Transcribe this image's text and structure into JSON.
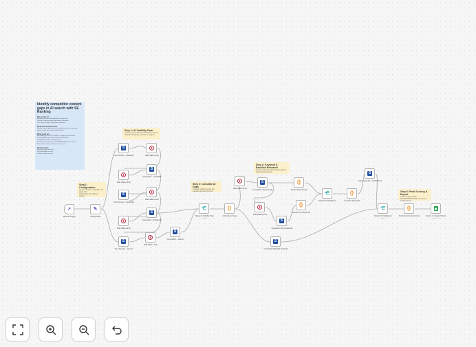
{
  "sticky_notes": {
    "main": {
      "title": "Identify competitor content gaps in AI search with SE Ranking",
      "who_heading": "Who is this for",
      "who_items": [
        "Marketing teams tracking AI SEO performance",
        "Content strategists planning editorial calendars",
        "SEO teams running competitor intelligence"
      ],
      "what_heading": "What this workflow does",
      "what_text": "Identify content opportunities by analyzing where competitors appear in AI search and traditional SEO.",
      "get_heading": "What you'll get",
      "get_items": [
        "AI visibility gaps across ChatGPT, Perplexity, and Gemini",
        "Keyword gaps with search volume and difficulty",
        "Competitor backlink authority metrics",
        "Prioritized opportunities with HIGH/MEDIUM/LOW ranking",
        "Actionable recommendations for each gap"
      ],
      "req_heading": "Requirements",
      "req_items": [
        "Self-hosted n8n instance",
        "SE Ranking API access",
        "Google Sheets account"
      ]
    },
    "step1": {
      "title": "Step 1: Configuration",
      "desc": "Set your domain, competitor, and target data",
      "desc2": "Change brand for different regions"
    },
    "step2": {
      "title": "Step 2: AI Visibility Data",
      "desc": "Fetch AI search data for both domains across ChatGPT, Perplexity, and Gemini engines"
    },
    "step3": {
      "title": "Step 3: Calculate AI Gaps",
      "desc": "Compare visibility metrics and calculate opportunity scores"
    },
    "step4": {
      "title": "Step 4: Keyword & Backlink Research",
      "desc": "Extract competitor top prompts, keywords, and backlink authority"
    },
    "step5": {
      "title": "Step 5: Final Scoring & Export",
      "desc": "Prioritize opportunities (HIGH/MEDIUM/LOW) and export to Google Sheets"
    }
  },
  "nodes": {
    "manual_trigger": {
      "label": "Manual Trigger",
      "icon": "cursor-icon"
    },
    "configuration": {
      "label": "Configuration",
      "icon": "pencil-icon"
    },
    "your_domain_chatgpt": {
      "label": "Your Domain – ChatGPT",
      "icon": "se-ranking-icon"
    },
    "wait_1": {
      "label": "Wait (Rate Limit)",
      "icon": "pause-icon"
    },
    "your_domain_perplexity": {
      "label": "Your Domain – Perplexity",
      "icon": "se-ranking-icon"
    },
    "wait_2": {
      "label": "Wait (Rate Limit)",
      "icon": "pause-icon"
    },
    "your_domain_gemini": {
      "label": "Your Domain – Gemini",
      "icon": "se-ranking-icon"
    },
    "wait_3": {
      "label": "Wait (Rate Limit)",
      "icon": "pause-icon"
    },
    "competitor_chatgpt": {
      "label": "Competitor – ChatGPT",
      "icon": "se-ranking-icon"
    },
    "wait_4": {
      "label": "Wait (Rate Limit)",
      "icon": "pause-icon"
    },
    "competitor_perplexity": {
      "label": "Competitor – Perplexity",
      "icon": "se-ranking-icon"
    },
    "wait_5": {
      "label": "Wait (Rate Limit)",
      "icon": "pause-icon"
    },
    "competitor_gemini": {
      "label": "Competitor – Gemini",
      "icon": "se-ranking-icon"
    },
    "merge_ai": {
      "label": "Merge AI Visibility Data",
      "sub": "append",
      "icon": "merge-icon"
    },
    "calculate_ai_gaps": {
      "label": "Calculate AI Gaps",
      "icon": "code-icon"
    },
    "wait_6": {
      "label": "Wait (Rate Limit)",
      "icon": "pause-icon"
    },
    "competitor_top_prompts": {
      "label": "Competitor Top Prompts",
      "icon": "se-ranking-icon"
    },
    "wait_7": {
      "label": "Wait (Rate Limit)",
      "icon": "pause-icon"
    },
    "competitor_top_keywords": {
      "label": "Competitor Top Keywords",
      "icon": "se-ranking-icon"
    },
    "competitor_backlink": {
      "label": "Competitor Backlink Authority",
      "icon": "se-ranking-icon"
    },
    "extract_top_prompts": {
      "label": "Extract Top Prompts",
      "icon": "code-icon"
    },
    "extract_top_keywords": {
      "label": "Extract Top Keywords",
      "icon": "code-icon"
    },
    "merge_all": {
      "label": "Merge All Intelligence",
      "icon": "merge-icon"
    },
    "combine_keywords": {
      "label": "Combine Keywords",
      "icon": "code-icon"
    },
    "gap_keywords": {
      "label": "Gap Keywords – Full Metrics",
      "icon": "se-ranking-icon"
    },
    "merge_all_2": {
      "label": "Merge All Intelligence",
      "sub": "append",
      "icon": "merge-icon"
    },
    "final_opportunity": {
      "label": "Final Opportunity Scoring",
      "icon": "code-icon"
    },
    "export_sheets": {
      "label": "Export to Google Sheets",
      "sub": "append: sheet",
      "icon": "google-sheets-icon"
    }
  },
  "controls": {
    "fit_view": "fit-view-icon",
    "zoom_in": "zoom-in-icon",
    "zoom_out": "zoom-out-icon",
    "reset": "undo-icon"
  }
}
